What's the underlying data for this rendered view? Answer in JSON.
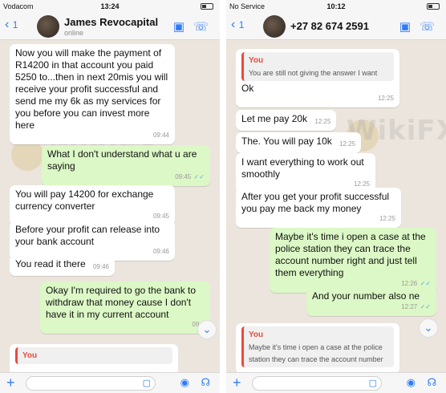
{
  "left": {
    "status": {
      "carrier": "Vodacom",
      "time": "13:24"
    },
    "header": {
      "back_count": "1",
      "name": "James Revocapital",
      "status": "online"
    },
    "messages": [
      {
        "dir": "in",
        "text": "Now you will make the payment of R14200 in that account you paid 5250 to...then in next 20mis you will receive your profit successful and send me my 6k as my services for you before you can invest more here",
        "time": "09:44"
      },
      {
        "dir": "out",
        "text": "What I don't understand what u are saying",
        "time": "09:45"
      },
      {
        "dir": "in",
        "text": "You will pay 14200 for exchange currency converter",
        "time": "09:45"
      },
      {
        "dir": "in",
        "text": "Before your profit can release into your bank account",
        "time": "09:46"
      },
      {
        "dir": "in",
        "text": "You read it there",
        "time": "09:46"
      },
      {
        "dir": "out",
        "text": "Okay I'm required to go the bank to withdraw that money cause I don't have it in my current account",
        "time": "09:4"
      },
      {
        "dir": "in",
        "quote_author": "You",
        "quote_text": ""
      }
    ]
  },
  "right": {
    "status": {
      "carrier": "No Service",
      "time": "10:12"
    },
    "header": {
      "back_count": "1",
      "name": "+27 82 674 2591"
    },
    "messages": [
      {
        "dir": "in",
        "quote_author": "You",
        "quote_text": "You are still not giving the answer I want"
      },
      {
        "dir": "in",
        "text": "Ok",
        "time": "12:25"
      },
      {
        "dir": "in",
        "text": "Let me pay 20k",
        "time": "12:25"
      },
      {
        "dir": "in",
        "text": "The. You will pay 10k",
        "time": "12:25"
      },
      {
        "dir": "in",
        "text": "I want everything to work out smoothly",
        "time": "12:25"
      },
      {
        "dir": "in",
        "text": "After you get your profit successful you pay me back my money",
        "time": "12:25"
      },
      {
        "dir": "out",
        "text": "Maybe it's time i open a case at the police station they can trace the account number right and just tell them everything",
        "time": "12:26"
      },
      {
        "dir": "out",
        "text": "And your number also ne",
        "time": "12:27"
      },
      {
        "dir": "in",
        "quote_author": "You",
        "quote_text": "Maybe it's time i open a case at the police station they can trace the account number"
      }
    ]
  },
  "watermark": "WikiFX",
  "icons": {
    "back": "chevron-left-icon",
    "video": "video-call-icon",
    "call": "phone-call-icon",
    "scroll": "scroll-down-icon",
    "plus": "plus-icon",
    "sticker": "sticker-icon",
    "camera": "camera-icon",
    "mic": "microphone-icon"
  },
  "colors": {
    "accent": "#2f7bf5",
    "outgoing": "#dcf8c6",
    "incoming": "#ffffff",
    "background": "#ece5dd",
    "quote_author": "#e74c3c"
  }
}
